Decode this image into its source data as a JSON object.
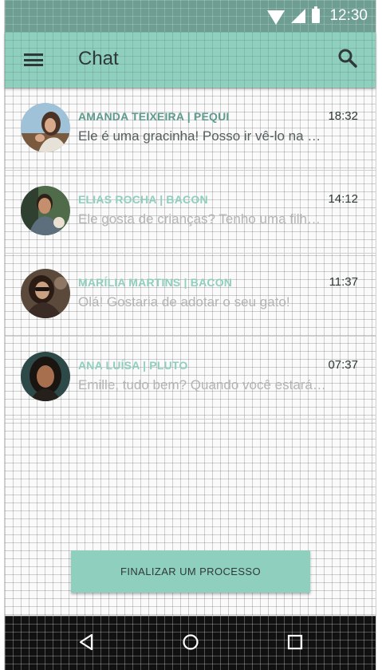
{
  "status_bar": {
    "time": "12:30",
    "icons": [
      "wifi-icon",
      "signal-icon",
      "battery-icon"
    ]
  },
  "app_bar": {
    "title": "Chat",
    "icons": [
      "menu-icon",
      "search-icon"
    ]
  },
  "chats": [
    {
      "name": "AMANDA TEIXEIRA | PEQUI",
      "time": "18:32",
      "preview": "Ele é uma gracinha! Posso ir vê-lo na próxima semana?",
      "state": "active"
    },
    {
      "name": "ELIAS ROCHA | BACON",
      "time": "14:12",
      "preview": "Ele gosta de crianças? Tenho uma filha pequena em casa.",
      "state": "faded"
    },
    {
      "name": "MARÍLIA MARTINS | BACON",
      "time": "11:37",
      "preview": "Olá! Gostaria de adotar o seu gato!",
      "state": "faded"
    },
    {
      "name": "ANA LUÍSA | PLUTO",
      "time": "07:37",
      "preview": "Emille, tudo bem? Quando você estará disponível?",
      "state": "faded"
    }
  ],
  "finalize_button": {
    "label": "FINALIZAR UM PROCESSO"
  },
  "nav_bar": {
    "icons": [
      "back-icon",
      "home-icon",
      "recent-apps-icon"
    ]
  },
  "colors": {
    "status_bar": "#6e9e92",
    "accent": "#8fcfbd",
    "accent_dark": "#5d9b8e",
    "nav_bar": "#111111"
  }
}
